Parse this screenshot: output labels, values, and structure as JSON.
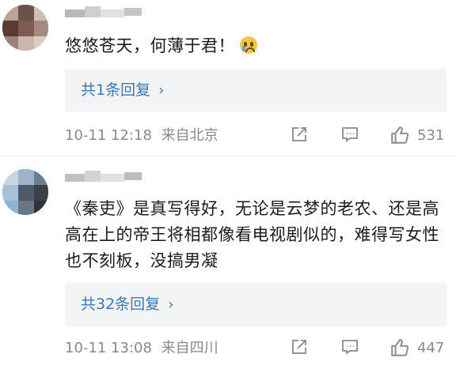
{
  "comments": [
    {
      "text": "悠悠苍天，何薄于君！",
      "emoji": "crying-emoji",
      "replies_label": "共1条回复",
      "time": "10-11 12:18",
      "location": "来自北京",
      "likes": "531"
    },
    {
      "text": "《秦吏》是真写得好，无论是云梦的老农、还是高高在上的帝王将相都像看电视剧似的，难得写女性也不刻板，没搞男凝",
      "replies_label": "共32条回复",
      "time": "10-11 13:08",
      "location": "来自四川",
      "likes": "447"
    }
  ],
  "icons": {
    "share": "share-icon",
    "comment": "comment-icon",
    "like": "thumbs-up-icon",
    "chevron": "chevron-right-icon"
  },
  "colors": {
    "link": "#3f77b0",
    "meta": "#8a8a8a",
    "reply_bg": "#f3f4f6"
  }
}
